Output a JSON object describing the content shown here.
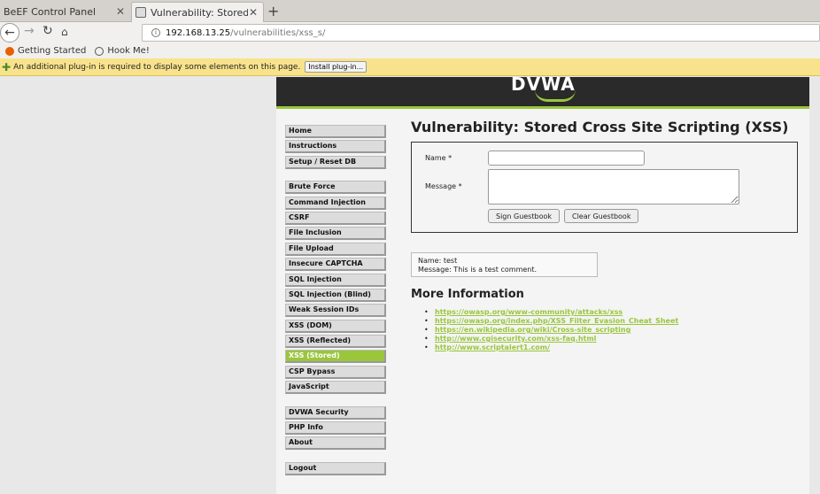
{
  "tabs": [
    {
      "title": "BeEF Control Panel"
    },
    {
      "title": "Vulnerability: Stored Cross Site Scripting (XSS)"
    }
  ],
  "tab_close": "✕",
  "new_tab": "+",
  "url": {
    "host": "192.168.13.25",
    "path": "/vulnerabilities/xss_s/"
  },
  "bookmarks": [
    {
      "label": "Getting Started"
    },
    {
      "label": "Hook Me!"
    }
  ],
  "plugin_bar": {
    "message": "An additional plug-in is required to display some elements on this page.",
    "button": "Install plug-in..."
  },
  "dvwa": {
    "logo": "DVWA",
    "menu": {
      "group1": [
        "Home",
        "Instructions",
        "Setup / Reset DB"
      ],
      "group2": [
        "Brute Force",
        "Command Injection",
        "CSRF",
        "File Inclusion",
        "File Upload",
        "Insecure CAPTCHA",
        "SQL Injection",
        "SQL Injection (Blind)",
        "Weak Session IDs",
        "XSS (DOM)",
        "XSS (Reflected)",
        "XSS (Stored)",
        "CSP Bypass",
        "JavaScript"
      ],
      "group3": [
        "DVWA Security",
        "PHP Info",
        "About"
      ],
      "group4": [
        "Logout"
      ],
      "active": "XSS (Stored)"
    },
    "page_title": "Vulnerability: Stored Cross Site Scripting (XSS)",
    "form": {
      "name_label": "Name *",
      "message_label": "Message *",
      "name_value": "",
      "message_value": "",
      "sign_button": "Sign Guestbook",
      "clear_button": "Clear Guestbook"
    },
    "comment": {
      "name_line": "Name: test",
      "message_line": "Message: This is a test comment."
    },
    "more_info_title": "More Information",
    "links": [
      "https://owasp.org/www-community/attacks/xss",
      "https://owasp.org/index.php/XSS_Filter_Evasion_Cheat_Sheet",
      "https://en.wikipedia.org/wiki/Cross-site_scripting",
      "http://www.cgisecurity.com/xss-faq.html",
      "http://www.scriptalert1.com/"
    ]
  },
  "colors": {
    "accent": "#9ac63c",
    "header": "#2a2a2a",
    "plugin_bar": "#f8e38c"
  }
}
